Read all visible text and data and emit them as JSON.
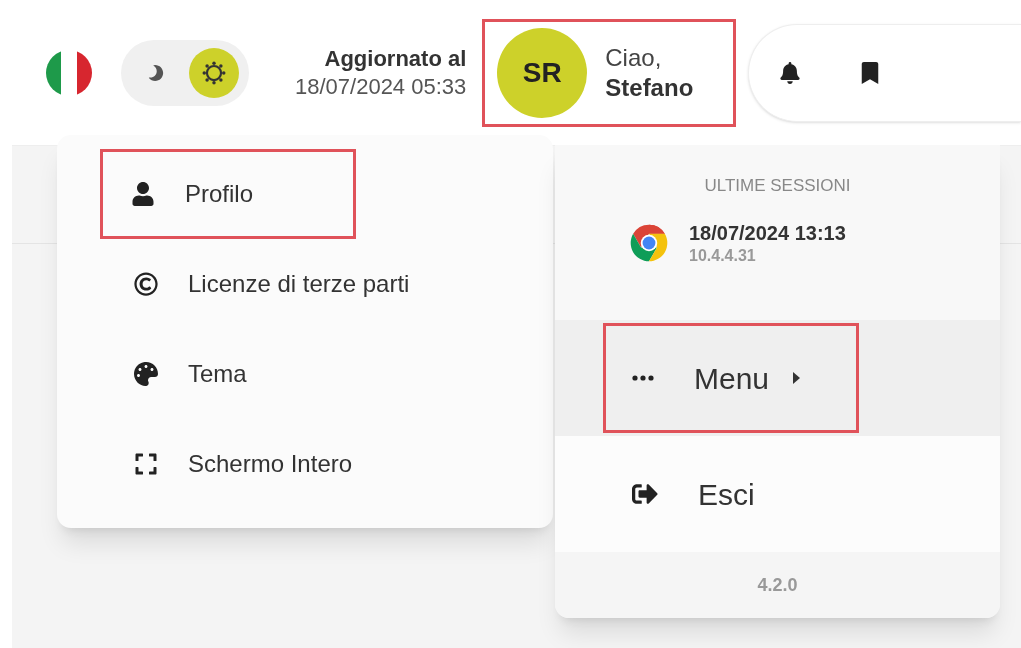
{
  "theme_toggle": {
    "options": [
      {
        "kind": "moon",
        "selected": false
      },
      {
        "kind": "sun",
        "selected": true
      }
    ]
  },
  "update": {
    "label": "Aggiornato al",
    "datetime": "18/07/2024 05:33"
  },
  "user": {
    "initials": "SR",
    "greeting": "Ciao,",
    "name": "Stefano",
    "highlighted": true
  },
  "actions": [
    {
      "kind": "bell"
    },
    {
      "kind": "bookmark"
    }
  ],
  "submenu": {
    "items": [
      {
        "kind": "person",
        "label": "Profilo",
        "highlighted": true
      },
      {
        "kind": "copyright",
        "label": "Licenze di terze parti",
        "highlighted": false
      },
      {
        "kind": "palette",
        "label": "Tema",
        "highlighted": false
      },
      {
        "kind": "fullscreen",
        "label": "Schermo Intero",
        "highlighted": false
      }
    ]
  },
  "user_menu": {
    "section_title": "ULTIME SESSIONI",
    "sessions": [
      {
        "datetime": "18/07/2024 13:13",
        "ip": "10.4.4.31"
      }
    ],
    "items": [
      {
        "kind": "submenu",
        "label": "Menu",
        "selected": true,
        "highlighted": true
      },
      {
        "kind": "logout",
        "label": "Esci",
        "selected": false,
        "highlighted": false
      }
    ],
    "version": "4.2.0"
  }
}
